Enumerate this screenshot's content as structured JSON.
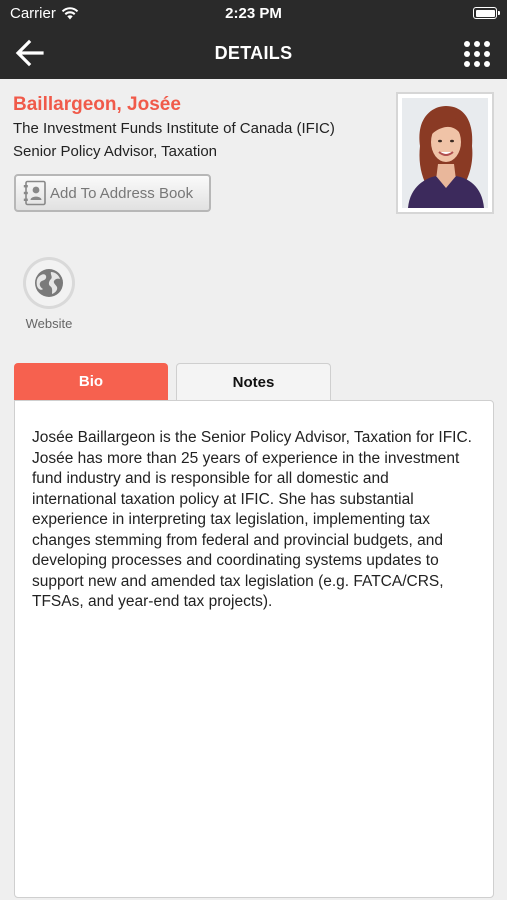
{
  "status_bar": {
    "carrier": "Carrier",
    "time": "2:23 PM"
  },
  "nav": {
    "title": "DETAILS",
    "back_icon": "arrow-left-icon",
    "menu_icon": "grid-menu-icon"
  },
  "profile": {
    "name": "Baillargeon, Josée",
    "organization": "The Investment Funds Institute of Canada (IFIC)",
    "title": "Senior Policy Advisor, Taxation",
    "add_to_address_book_label": "Add To Address Book",
    "photo_alt": "Profile photo"
  },
  "links": {
    "website_label": "Website"
  },
  "tabs": [
    {
      "label": "Bio",
      "active": true
    },
    {
      "label": "Notes",
      "active": false
    }
  ],
  "bio": {
    "text": "Josée Baillargeon is the Senior Policy Advisor, Taxation for IFIC. Josée has more than 25 years of experience in the investment fund industry and is responsible for all domestic and international taxation policy at IFIC. She has substantial experience in interpreting tax legislation, implementing tax changes stemming from federal and provincial budgets, and developing processes and coordinating systems updates to support new and amended tax legislation (e.g. FATCA/CRS, TFSAs, and year-end tax projects)."
  },
  "colors": {
    "accent": "#f05a4a",
    "active_tab": "#f6614f",
    "nav_background": "#2a2a2a",
    "page_background": "#efefef"
  }
}
